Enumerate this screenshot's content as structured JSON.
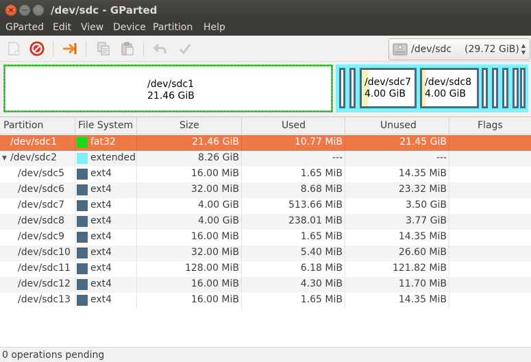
{
  "window": {
    "title": "/dev/sdc - GParted"
  },
  "menu": [
    "GParted",
    "Edit",
    "View",
    "Device",
    "Partition",
    "Help"
  ],
  "toolbar": {
    "buttons": [
      {
        "name": "new-partition",
        "icon": "new-icon"
      },
      {
        "name": "delete-partition",
        "icon": "delete-icon"
      },
      {
        "name": "resize-move",
        "icon": "resize-icon"
      },
      {
        "name": "copy",
        "icon": "copy-icon"
      },
      {
        "name": "paste",
        "icon": "paste-icon"
      },
      {
        "name": "undo",
        "icon": "undo-icon"
      },
      {
        "name": "apply",
        "icon": "apply-icon"
      }
    ],
    "device": {
      "name": "/dev/sdc",
      "size": "(29.72 GiB)",
      "icon": "harddisk-icon"
    }
  },
  "diskmap": {
    "p1": {
      "name": "/dev/sdc1",
      "size": "21.46 GiB"
    },
    "sdc7": {
      "name": "/dev/sdc7",
      "size": "4.00 GiB"
    },
    "sdc8": {
      "name": "/dev/sdc8",
      "size": "4.00 GiB"
    }
  },
  "table": {
    "columns": [
      "Partition",
      "File System",
      "Size",
      "Used",
      "Unused",
      "Flags"
    ],
    "rows": [
      {
        "partition": "/dev/sdc1",
        "fs": "fat32",
        "color": "#18d818",
        "size": "21.46 GiB",
        "used": "10.77 MiB",
        "unused": "21.45 GiB",
        "flags": ""
      },
      {
        "partition": "/dev/sdc2",
        "fs": "extended",
        "color": "#7ef0f7",
        "size": "8.26 GiB",
        "used": "---",
        "unused": "---",
        "flags": ""
      },
      {
        "partition": "/dev/sdc5",
        "fs": "ext4",
        "color": "#4b6983",
        "size": "16.00 MiB",
        "used": "1.65 MiB",
        "unused": "14.35 MiB",
        "flags": ""
      },
      {
        "partition": "/dev/sdc6",
        "fs": "ext4",
        "color": "#4b6983",
        "size": "32.00 MiB",
        "used": "8.68 MiB",
        "unused": "23.32 MiB",
        "flags": ""
      },
      {
        "partition": "/dev/sdc7",
        "fs": "ext4",
        "color": "#4b6983",
        "size": "4.00 GiB",
        "used": "513.66 MiB",
        "unused": "3.50 GiB",
        "flags": ""
      },
      {
        "partition": "/dev/sdc8",
        "fs": "ext4",
        "color": "#4b6983",
        "size": "4.00 GiB",
        "used": "238.01 MiB",
        "unused": "3.77 GiB",
        "flags": ""
      },
      {
        "partition": "/dev/sdc9",
        "fs": "ext4",
        "color": "#4b6983",
        "size": "16.00 MiB",
        "used": "1.65 MiB",
        "unused": "14.35 MiB",
        "flags": ""
      },
      {
        "partition": "/dev/sdc10",
        "fs": "ext4",
        "color": "#4b6983",
        "size": "32.00 MiB",
        "used": "5.40 MiB",
        "unused": "26.60 MiB",
        "flags": ""
      },
      {
        "partition": "/dev/sdc11",
        "fs": "ext4",
        "color": "#4b6983",
        "size": "128.00 MiB",
        "used": "6.18 MiB",
        "unused": "121.82 MiB",
        "flags": ""
      },
      {
        "partition": "/dev/sdc12",
        "fs": "ext4",
        "color": "#4b6983",
        "size": "16.00 MiB",
        "used": "4.30 MiB",
        "unused": "11.70 MiB",
        "flags": ""
      },
      {
        "partition": "/dev/sdc13",
        "fs": "ext4",
        "color": "#4b6983",
        "size": "16.00 MiB",
        "used": "1.65 MiB",
        "unused": "14.35 MiB",
        "flags": ""
      }
    ]
  },
  "status": {
    "text": "0 operations pending"
  }
}
